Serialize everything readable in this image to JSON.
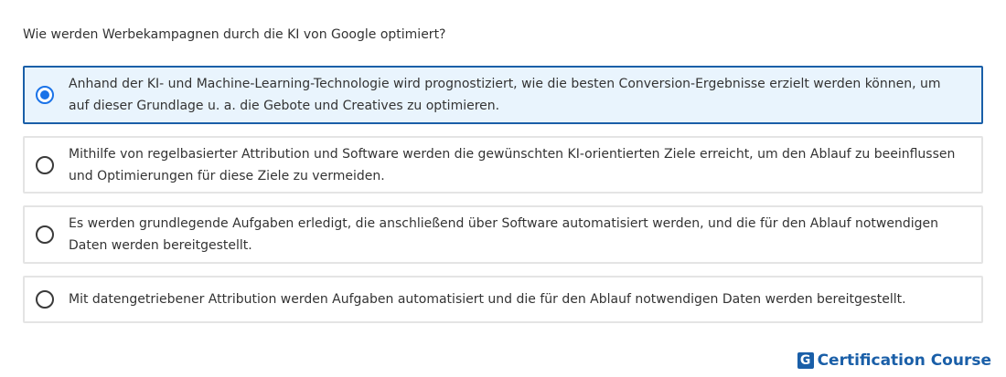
{
  "question": "Wie werden Werbekampagnen durch die KI von Google optimiert?",
  "options": [
    {
      "text": "Anhand der KI- und Machine-Learning-Technologie wird prognostiziert, wie die besten Conversion-Ergebnisse erzielt werden können, um auf dieser Grundlage u. a. die Gebote und Creatives zu optimieren.",
      "selected": true
    },
    {
      "text": "Mithilfe von regelbasierter Attribution und Software werden die gewünschten KI-orientierten Ziele erreicht, um den Ablauf zu beeinflussen und Optimierungen für diese Ziele zu vermeiden.",
      "selected": false
    },
    {
      "text": "Es werden grundlegende Aufgaben erledigt, die anschließend über Software automatisiert werden, und die für den Ablauf notwendigen Daten werden bereitgestellt.",
      "selected": false
    },
    {
      "text": "Mit datengetriebener Attribution werden Aufgaben automatisiert und die für den Ablauf notwendigen Daten werden bereitgestellt.",
      "selected": false
    }
  ],
  "brand": {
    "logo_letter": "G",
    "name": "Certification Course"
  },
  "colors": {
    "selected_border": "#1a5fa8",
    "selected_background": "#e9f4fd",
    "radio_checked": "#1a73e8",
    "brand": "#1a5fa8"
  }
}
